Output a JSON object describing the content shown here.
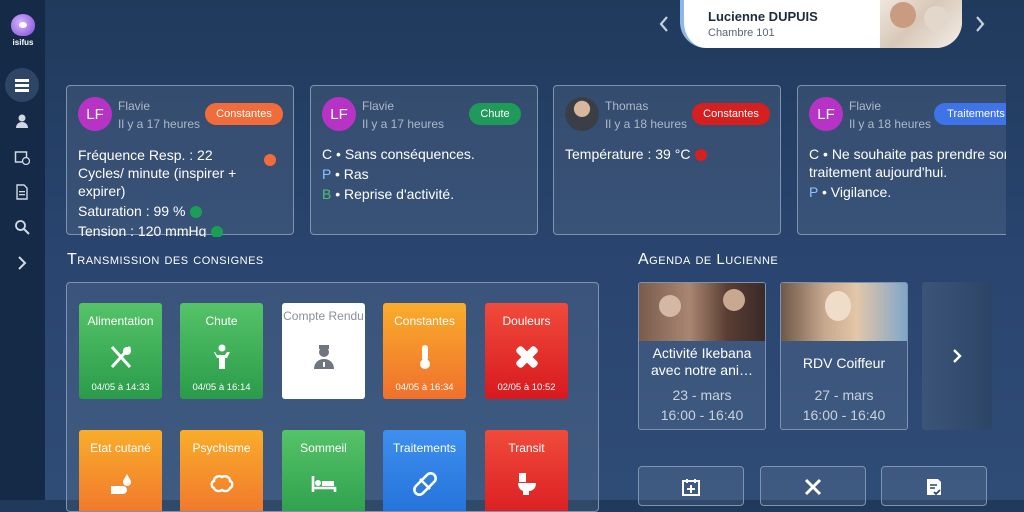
{
  "app": {
    "logo_text": "isifus"
  },
  "sidebar": {
    "items": [
      {
        "icon": "list-icon"
      },
      {
        "icon": "resident-icon"
      },
      {
        "icon": "calendar-clock-icon"
      },
      {
        "icon": "document-icon"
      },
      {
        "icon": "search-icon"
      },
      {
        "icon": "chevron-right-icon"
      }
    ]
  },
  "patient": {
    "name": "Lucienne DUPUIS",
    "room": "Chambre 101"
  },
  "transmissions": [
    {
      "author": "Flavie",
      "initials": "LF",
      "time": "Il y a 17 heures",
      "tag": "Constantes",
      "tag_color": "#f26b3a",
      "lines": [
        {
          "text": "Fréquence Resp. : 22 Cycles/ minute (inspirer + expirer)",
          "dot": "#f26b3a"
        },
        {
          "text": "Saturation : 99 %",
          "dot": "#1aa056"
        },
        {
          "text": "Tension : 120 mmHg",
          "dot": "#1aa056"
        }
      ]
    },
    {
      "author": "Flavie",
      "initials": "LF",
      "time": "Il y a 17 heures",
      "tag": "Chute",
      "tag_color": "#1f9a5a",
      "lines": [
        {
          "prefix": "C",
          "prefix_color": "#ffffff",
          "text": "Sans conséquences."
        },
        {
          "prefix": "P",
          "prefix_color": "#8fc0ff",
          "text": "Ras"
        },
        {
          "prefix": "B",
          "prefix_color": "#4cc46f",
          "text": "Reprise d'activité."
        }
      ]
    },
    {
      "author": "Thomas",
      "initials": "",
      "time": "Il y a 18 heures",
      "tag": "Constantes",
      "tag_color": "#d61f1f",
      "lines": [
        {
          "text": "Température : 39 °C",
          "dot": "#d61f1f"
        }
      ]
    },
    {
      "author": "Flavie",
      "initials": "LF",
      "time": "Il y a 18 heures",
      "tag": "Traitements",
      "tag_color": "#3e74e8",
      "lines": [
        {
          "prefix": "C",
          "prefix_color": "#ffffff",
          "text": "Ne souhaite pas prendre son traitement aujourd'hui."
        },
        {
          "prefix": "P",
          "prefix_color": "#8fc0ff",
          "text": "Vigilance."
        }
      ]
    }
  ],
  "consignes": {
    "title_first": "T",
    "title_rest": "ransmission des consignes",
    "tiles": [
      {
        "label": "Alimentation",
        "icon": "utensils-icon",
        "date": "04/05 à 14:33",
        "color": "#2a9b4a",
        "color2": "#55c368"
      },
      {
        "label": "Chute",
        "icon": "person-icon",
        "date": "04/05 à 16:14",
        "color": "#2a9b4a",
        "color2": "#55c368"
      },
      {
        "label": "Compte Rendu",
        "icon": "doctor-icon",
        "date": "",
        "color": "#ffffff",
        "color2": "#ffffff"
      },
      {
        "label": "Constantes",
        "icon": "thermometer-icon",
        "date": "04/05 à 16:34",
        "color": "#f0702c",
        "color2": "#f9ad2b"
      },
      {
        "label": "Douleurs",
        "icon": "bandage-icon",
        "date": "02/05 à 10:52",
        "color": "#d8191e",
        "color2": "#f04b3c"
      },
      {
        "label": "Etat cutané",
        "icon": "hand-drop-icon",
        "date": "",
        "color": "#f0702c",
        "color2": "#f9ad2b"
      },
      {
        "label": "Psychisme",
        "icon": "brain-icon",
        "date": "",
        "color": "#f0702c",
        "color2": "#f9ad2b"
      },
      {
        "label": "Sommeil",
        "icon": "bed-icon",
        "date": "",
        "color": "#2a9b4a",
        "color2": "#55c368"
      },
      {
        "label": "Traitements",
        "icon": "pill-icon",
        "date": "",
        "color": "#1f6fd6",
        "color2": "#3f8ff0"
      },
      {
        "label": "Transit",
        "icon": "toilet-icon",
        "date": "",
        "color": "#d8191e",
        "color2": "#f04b3c"
      }
    ]
  },
  "agenda": {
    "title_first": "A",
    "title_rest": "genda de Lucienne",
    "events": [
      {
        "name": "Activité Ikebana avec notre ani…",
        "date": "23 - mars",
        "time": "16:00 - 16:40"
      },
      {
        "name": "RDV Coiffeur",
        "date": "27 - mars",
        "time": "16:00 - 16:40"
      }
    ]
  },
  "quick_actions": [
    {
      "icon": "calendar-add-icon"
    },
    {
      "icon": "tools-icon"
    },
    {
      "icon": "checklist-icon"
    }
  ]
}
